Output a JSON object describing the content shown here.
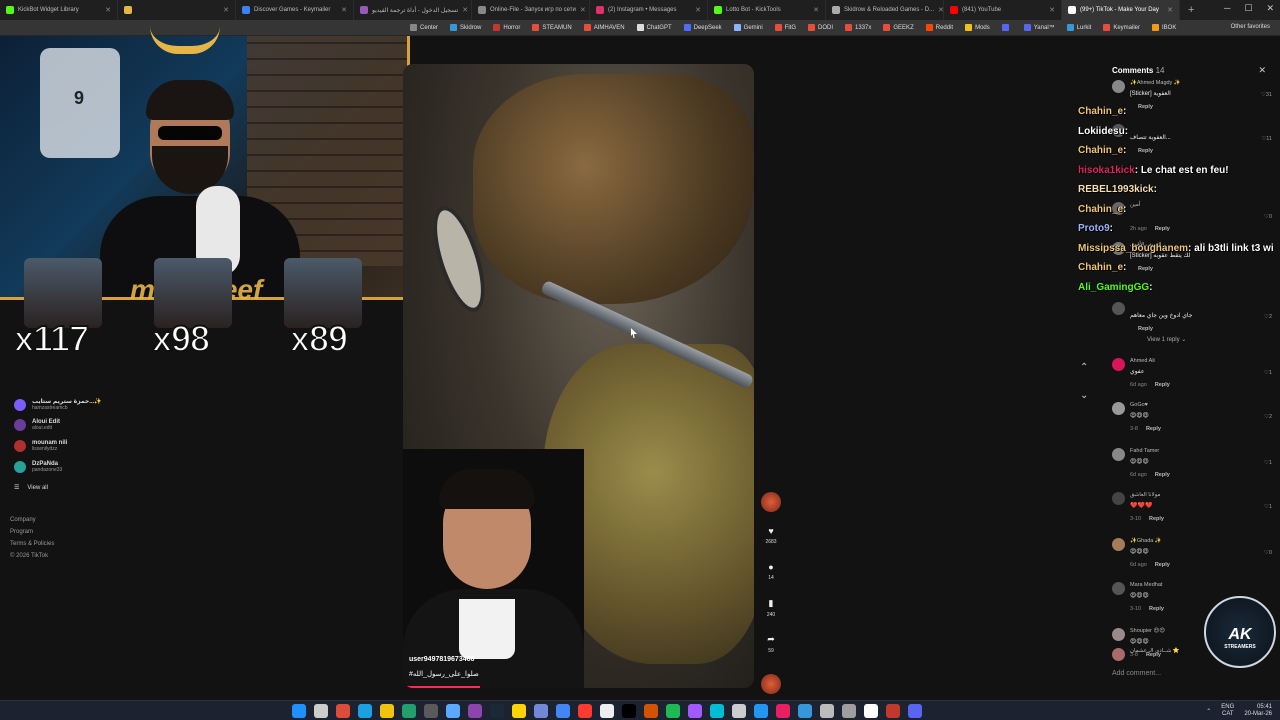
{
  "browser": {
    "tabs": [
      {
        "title": "KickBot Widget Library",
        "color": "#53fc18",
        "active": false
      },
      {
        "title": "",
        "color": "#e5b548",
        "active": false
      },
      {
        "title": "Discover Games - Keymailer",
        "color": "#3b82f6",
        "active": false
      },
      {
        "title": "تسجيل الدخول - أداة ترجمة الفيديو",
        "color": "#9b59b6",
        "active": false
      },
      {
        "title": "Online-File - Запуск игр по сети",
        "color": "#888888",
        "active": false
      },
      {
        "title": "(2) Instagram • Messages",
        "color": "#e1306c",
        "active": false
      },
      {
        "title": "Lotto Bot - KickTools",
        "color": "#53fc18",
        "active": false
      },
      {
        "title": "Skidrow & Reloaded Games - D...",
        "color": "#aaaaaa",
        "active": false
      },
      {
        "title": "(841) YouTube",
        "color": "#ff0000",
        "active": false
      },
      {
        "title": "(99+) TikTok - Make Your Day",
        "color": "#ffffff",
        "active": true
      }
    ],
    "new_tab": "+",
    "window_controls": {
      "minimize": "─",
      "maximize": "☐",
      "close": "✕"
    },
    "bookmarks": [
      {
        "label": "Center",
        "color": "#888888"
      },
      {
        "label": "Skidrow",
        "color": "#3498db"
      },
      {
        "label": "Horror",
        "color": "#c0392b"
      },
      {
        "label": "STEAMUN",
        "color": "#e74c3c"
      },
      {
        "label": "AIMHAVEN",
        "color": "#e74c3c"
      },
      {
        "label": "ChatGPT",
        "color": "#dddddd"
      },
      {
        "label": "DeepSeek",
        "color": "#4d6bfe"
      },
      {
        "label": "Gemini",
        "color": "#8ab4f8"
      },
      {
        "label": "FitG",
        "color": "#e74c3c"
      },
      {
        "label": "DODI",
        "color": "#e74c3c"
      },
      {
        "label": "1337x",
        "color": "#e74c3c"
      },
      {
        "label": "GEEKZ",
        "color": "#e74c3c"
      },
      {
        "label": "Reddit",
        "color": "#ff4500"
      },
      {
        "label": "Mods",
        "color": "#f1c40f"
      },
      {
        "label": "",
        "color": "#5865f2"
      },
      {
        "label": "Yanal™",
        "color": "#5865f2"
      },
      {
        "label": "Lurkit",
        "color": "#3498db"
      },
      {
        "label": "Keymailer",
        "color": "#e74c3c"
      },
      {
        "label": "IBOK",
        "color": "#f39c12"
      }
    ],
    "other_favorites": "Other favorites"
  },
  "stream": {
    "jersey_number": "9",
    "multipliers": [
      "x117",
      "x98",
      "x89"
    ],
    "banner_name": "mad   areef"
  },
  "sidebar": {
    "following": [
      {
        "name": "حمزة ستريم ستايب...✨",
        "handle": "hamzastreamcb",
        "color": "#7a5cff"
      },
      {
        "name": "Aloui Edit",
        "handle": "aloui.edit",
        "color": "#6a3d9a"
      },
      {
        "name": "mounam nili",
        "handle": "lissenilydzz",
        "color": "#b03030"
      },
      {
        "name": "DzPaNda",
        "handle": "pandazone33",
        "color": "#2aa198"
      }
    ],
    "view_all": "View all",
    "footer": [
      "Company",
      "Program",
      "Terms & Policies",
      "© 2026 TikTok"
    ]
  },
  "video": {
    "username": "user9497819673466",
    "caption": "#صلوا_على_رسول_الله",
    "progress_percent": 22
  },
  "actions": {
    "likes": "2683",
    "comments": "14",
    "saves": "240",
    "shares": "59"
  },
  "comments_panel": {
    "title": "Comments",
    "count": "14",
    "reply_label": "Reply",
    "view_reply": "View 1 reply ⌄",
    "add_comment": "Add comment...",
    "items": [
      {
        "name": "✨Ahmed Magdy ✨",
        "text": "[Sticker] العفوية",
        "meta": "",
        "likes": "31",
        "color": "#888888"
      },
      {
        "name": "",
        "text": "العفوية تتصاف...",
        "meta": "",
        "likes": "11",
        "color": "#555555"
      },
      {
        "name": "أمين",
        "text": "",
        "meta": "2h ago",
        "likes": "0",
        "color": "#666666"
      },
      {
        "name": "السيف الأقوى",
        "text": "[Sticker] لك يتقط عقوبه",
        "meta": "",
        "likes": "",
        "color": "#777777"
      },
      {
        "name": "",
        "text": "جاي ادوخ وين جاي معاهم",
        "meta": "",
        "likes": "2",
        "color": "#555555"
      },
      {
        "name": "Ahmed Ali",
        "text": "عفوي",
        "meta": "6d ago",
        "likes": "1",
        "color": "#d9145a"
      },
      {
        "name": "GoGo♥",
        "text": "😍😍😍",
        "meta": "3-8",
        "likes": "2",
        "color": "#999999"
      },
      {
        "name": "Fahd Tamer",
        "text": "😍😍😍",
        "meta": "6d ago",
        "likes": "1",
        "color": "#888888"
      },
      {
        "name": "مولانا العاشق",
        "text": "❤️❤️❤️",
        "meta": "3-10",
        "likes": "1",
        "color": "#444444"
      },
      {
        "name": "✨Ghada ✨",
        "text": "😍😍😍",
        "meta": "6d ago",
        "likes": "0",
        "color": "#a57c5a"
      },
      {
        "name": "Mara Medhat",
        "text": "😍😍😍",
        "meta": "3-10",
        "likes": "",
        "color": "#555555"
      },
      {
        "name": "Shoupier 😍😍",
        "text": "😍😍😍",
        "meta": "3-8",
        "likes": "2",
        "color": "#9a8a8a"
      },
      {
        "name": "شــادي الـ عشمان ⭐",
        "text": "",
        "meta": "",
        "likes": "",
        "color": "#aa6a6a"
      }
    ]
  },
  "chat": [
    {
      "user": "Chahin_e",
      "msg": ":",
      "color": "#f0c674"
    },
    {
      "user": "Lokiidesu",
      "msg": ":",
      "color": "#ffffff"
    },
    {
      "user": "Chahin_e",
      "msg": ":",
      "color": "#f0c674"
    },
    {
      "user": "hisoka1kick",
      "msg": ": Le chat est en feu!",
      "color": "#e0245e"
    },
    {
      "user": "REBEL1993kick",
      "msg": ":",
      "color": "#f5deb3"
    },
    {
      "user": "Chahin_e",
      "msg": ":",
      "color": "#f0c674"
    },
    {
      "user": "Proto9",
      "msg": ":",
      "color": "#9fb4ff"
    },
    {
      "user": "Missipssa_boughanem",
      "msg": ": ali b3tli link t3 wi",
      "color": "#f0c674"
    },
    {
      "user": "Chahin_e",
      "msg": ":",
      "color": "#f0c674"
    },
    {
      "user": "Ali_GamingGG",
      "msg": ":",
      "color": "#53fc18"
    }
  ],
  "logo": {
    "big": "AK",
    "small": "STREAMERS"
  },
  "taskbar": {
    "icons": [
      "#1e90ff",
      "#cccccc",
      "#dd4b39",
      "#1ba1e2",
      "#f1c40f",
      "#22a06b",
      "#5a5a5a",
      "#5aa9ff",
      "#8e44ad",
      "#1b2838",
      "#ffd400",
      "#7289da",
      "#4285f4",
      "#ff3b30",
      "#eeeeee",
      "#000000",
      "#d35400",
      "#1db954",
      "#a259ff",
      "#00bcd4",
      "#cccccc",
      "#2196f3",
      "#e91e63",
      "#3498db",
      "#bbbbbb",
      "#9e9e9e",
      "#ffffff",
      "#c0392b",
      "#5865f2"
    ],
    "lang": "ENG",
    "region": "CAT",
    "time": "05:41",
    "date": "20-Mar-26"
  }
}
